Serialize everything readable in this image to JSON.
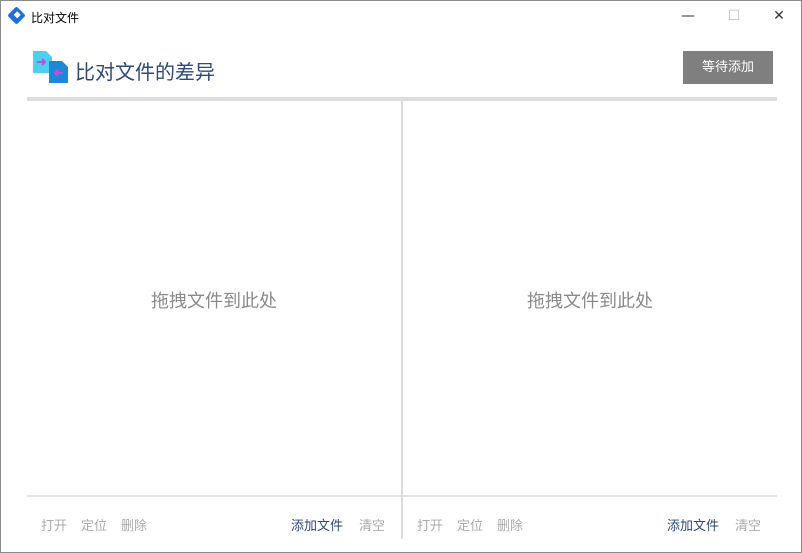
{
  "window": {
    "title": "比对文件",
    "minimize": "—",
    "maximize": "☐",
    "close": "✕"
  },
  "header": {
    "title": "比对文件的差异",
    "status_button": "等待添加"
  },
  "panels": [
    {
      "drop_hint": "拖拽文件到此处",
      "actions": {
        "open": "打开",
        "locate": "定位",
        "delete": "删除",
        "add": "添加文件",
        "clear": "清空"
      }
    },
    {
      "drop_hint": "拖拽文件到此处",
      "actions": {
        "open": "打开",
        "locate": "定位",
        "delete": "删除",
        "add": "添加文件",
        "clear": "清空"
      }
    }
  ]
}
